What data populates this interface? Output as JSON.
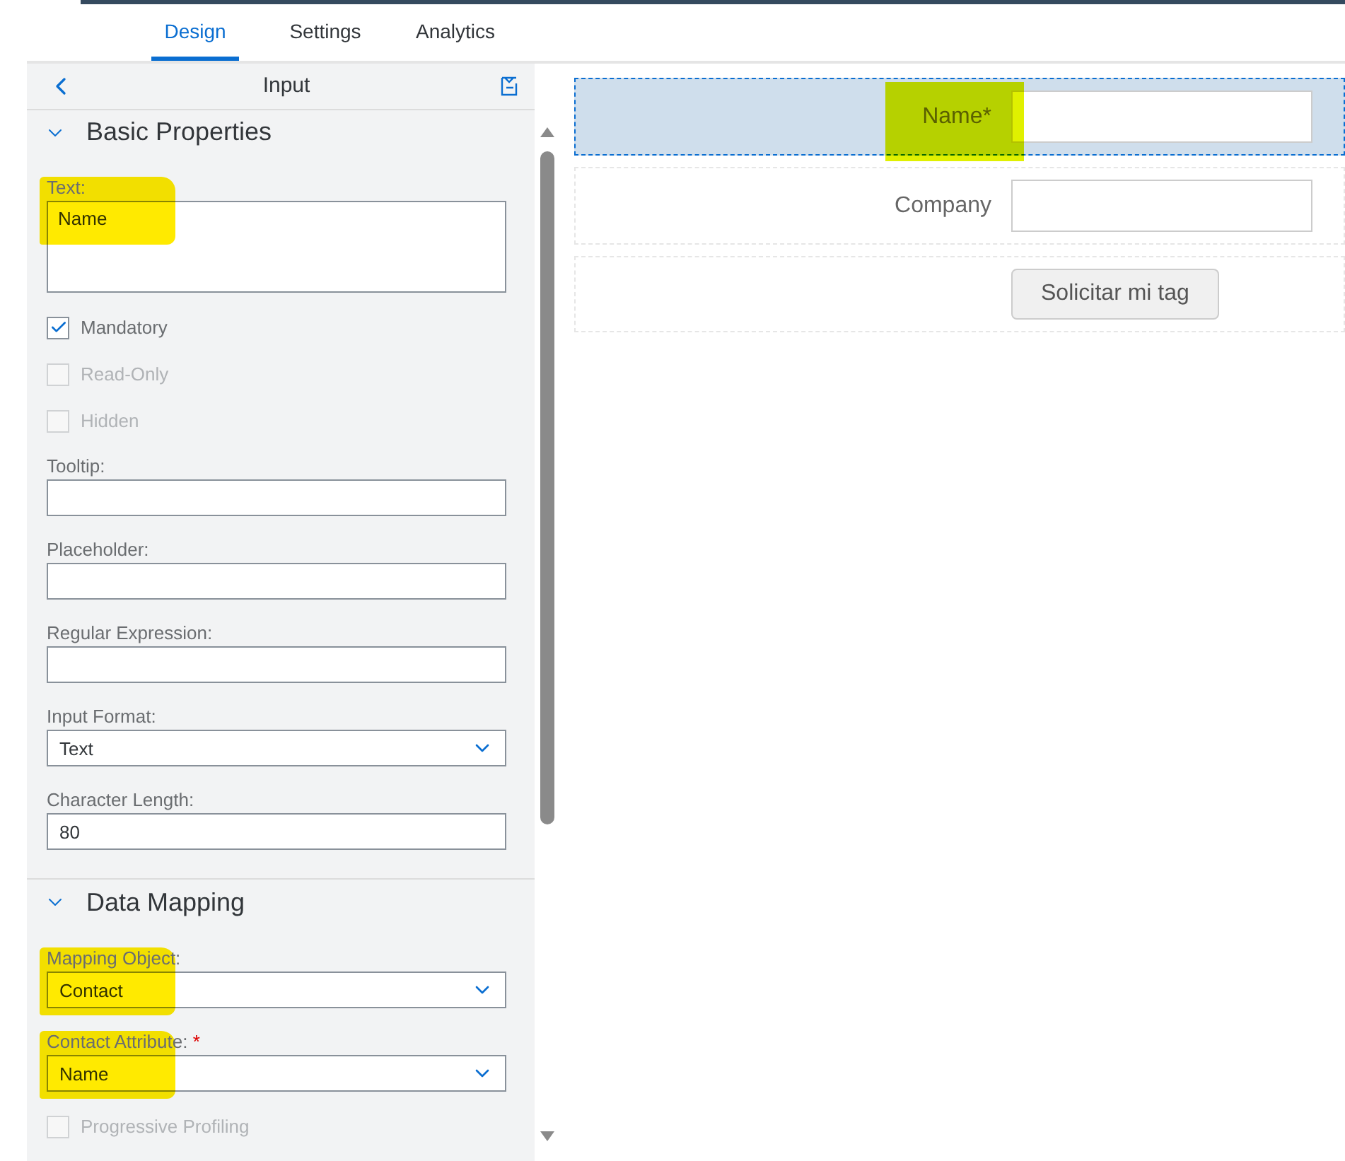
{
  "tabs": [
    {
      "label": "Design",
      "selected": true
    },
    {
      "label": "Settings",
      "selected": false
    },
    {
      "label": "Analytics",
      "selected": false
    }
  ],
  "panel": {
    "title": "Input",
    "sections": [
      {
        "title": "Basic Properties",
        "expanded": true,
        "items": [
          {
            "kind": "textarea",
            "label": "Text:",
            "value": "Name",
            "highlighted": true
          },
          {
            "kind": "checkbox",
            "label": "Mandatory",
            "checked": true,
            "disabled": false
          },
          {
            "kind": "checkbox",
            "label": "Read-Only",
            "checked": false,
            "disabled": true
          },
          {
            "kind": "checkbox",
            "label": "Hidden",
            "checked": false,
            "disabled": true
          },
          {
            "kind": "input",
            "label": "Tooltip:"
          },
          {
            "kind": "input",
            "label": "Placeholder:"
          },
          {
            "kind": "input",
            "label": "Regular Expression:"
          },
          {
            "kind": "select",
            "label": "Input Format:",
            "value": "Text"
          },
          {
            "kind": "input",
            "label": "Character Length:",
            "value": "80"
          }
        ]
      },
      {
        "title": "Data Mapping",
        "expanded": true,
        "items": [
          {
            "kind": "select",
            "label": "Mapping Object:",
            "value": "Contact",
            "highlighted": true
          },
          {
            "kind": "select",
            "label": "Contact Attribute:",
            "value": "Name",
            "required_mark": "*",
            "highlighted": true
          },
          {
            "kind": "checkbox",
            "label": "Progressive Profiling",
            "checked": false,
            "disabled": true
          }
        ]
      }
    ]
  },
  "canvas": {
    "rows": [
      {
        "kind": "input",
        "label": "Name*",
        "selected": true,
        "highlighted": true
      },
      {
        "kind": "input",
        "label": "Company",
        "selected": false
      },
      {
        "kind": "button",
        "label": "Solicitar mi tag",
        "selected": false
      }
    ]
  }
}
